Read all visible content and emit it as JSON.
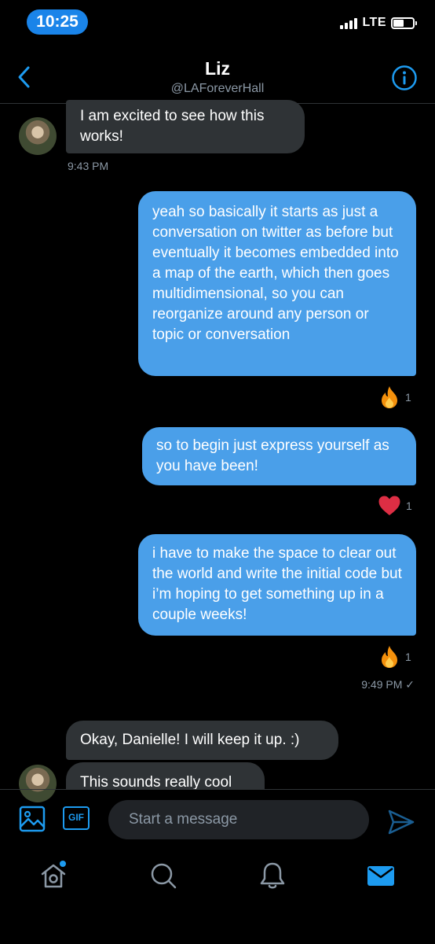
{
  "status_bar": {
    "time": "10:25",
    "network": "LTE"
  },
  "header": {
    "name": "Liz",
    "handle": "@LAForeverHall"
  },
  "messages": [
    {
      "text": "I am excited to see how this works!",
      "direction": "incoming",
      "timestamp": "9:43 PM"
    },
    {
      "text": "yeah so basically it starts as just a conversation on twitter as before but eventually it becomes embedded into a map of the earth, which then goes multidimensional, so you can reorganize around any person or topic or conversation",
      "direction": "outgoing",
      "reaction": {
        "icon": "fire-icon",
        "count": "1"
      }
    },
    {
      "text": "so to begin just express yourself as you have been!",
      "direction": "outgoing",
      "reaction": {
        "icon": "heart-icon",
        "count": "1"
      }
    },
    {
      "text": "i have to make the space to clear out the world and write the initial code but i’m hoping to get something up in a couple weeks!",
      "direction": "outgoing",
      "reaction": {
        "icon": "fire-icon",
        "count": "1"
      },
      "timestamp": "9:49 PM ✓"
    },
    {
      "text": "Okay, Danielle! I will keep it up. :)",
      "direction": "incoming"
    },
    {
      "text": "This sounds really cool",
      "direction": "incoming"
    }
  ],
  "composer": {
    "placeholder": "Start a message",
    "gif_label": "GIF"
  },
  "tabs": [
    {
      "name": "home",
      "icon": "home-icon",
      "has_notification_dot": true
    },
    {
      "name": "search",
      "icon": "search-icon"
    },
    {
      "name": "notifications",
      "icon": "bell-icon"
    },
    {
      "name": "messages",
      "icon": "mail-icon",
      "active": true
    }
  ],
  "colors": {
    "accent": "#1d9bf0",
    "outgoing_bubble": "#4a9fe9",
    "incoming_bubble": "#2f3336",
    "muted_text": "#8b98a5",
    "status_pill": "#1a84e9"
  }
}
